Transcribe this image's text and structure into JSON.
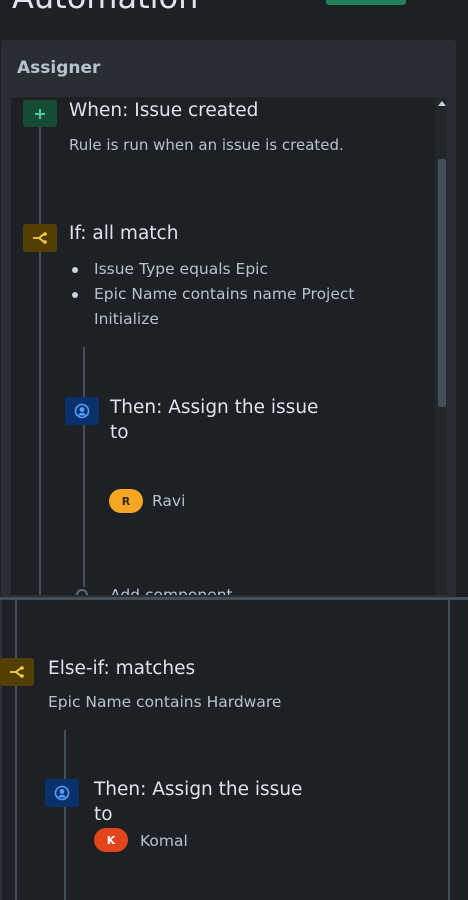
{
  "page": {
    "title": "Automation"
  },
  "panel": {
    "title": "Assigner"
  },
  "trigger": {
    "icon": "plus-icon",
    "title": "When: Issue created",
    "description": "Rule is run when an issue is created."
  },
  "condition": {
    "icon": "branch-icon",
    "title": "If: all match",
    "items": [
      "Issue Type equals Epic",
      "Epic Name contains name Project Initialize"
    ]
  },
  "action1": {
    "icon": "user-circle-icon",
    "title_line1": "Then: Assign the issue",
    "title_line2": "to",
    "assignee": {
      "initial": "R",
      "name": "Ravi",
      "color": "#f5a623"
    }
  },
  "add_component": {
    "label": "Add component"
  },
  "else_if": {
    "icon": "branch-icon",
    "title": "Else-if: matches",
    "description": "Epic Name contains Hardware"
  },
  "action2": {
    "icon": "user-circle-icon",
    "title_line1": "Then: Assign the issue",
    "title_line2": "to",
    "assignee": {
      "initial": "K",
      "name": "Komal",
      "color": "#e2441c"
    }
  },
  "colors": {
    "background": "#1d2125",
    "panel": "#282e33",
    "trigger": "#4bce97",
    "condition": "#f5cd47",
    "action": "#579dff"
  }
}
